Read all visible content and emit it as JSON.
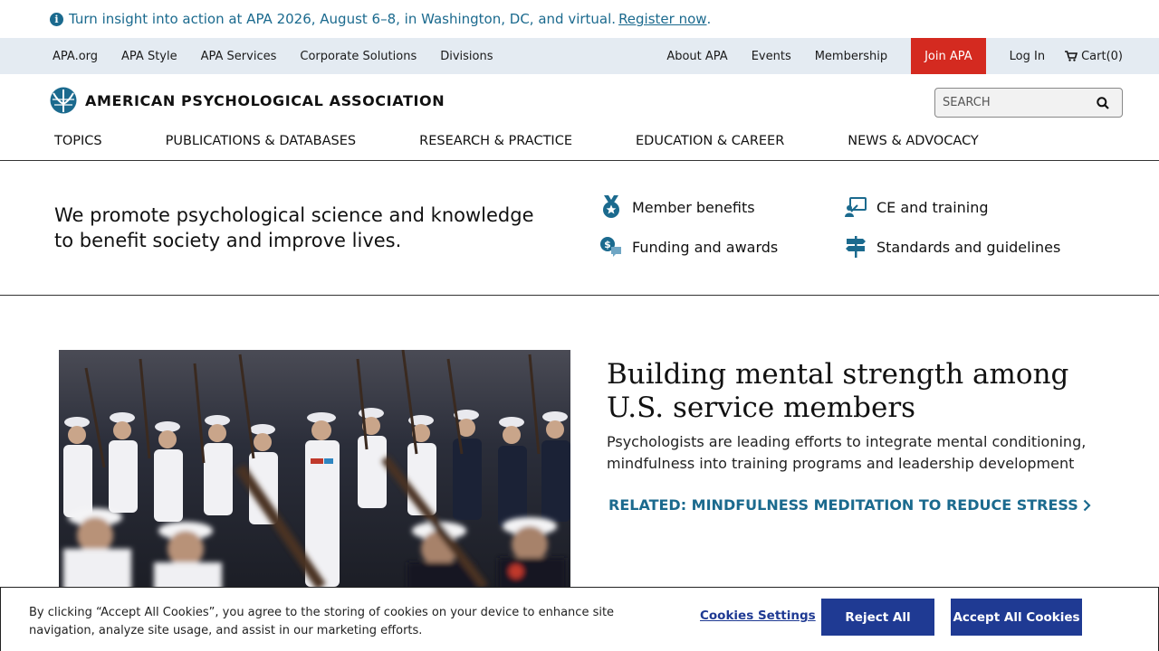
{
  "alert": {
    "message": "Turn insight into action at APA 2026, August 6–8, in Washington, DC, and virtual.",
    "link": "Register now",
    "trailing": "."
  },
  "util_nav": {
    "left": [
      "APA.org",
      "APA Style",
      "APA Services",
      "Corporate Solutions",
      "Divisions"
    ],
    "about": "About APA",
    "events": "Events",
    "membership": "Membership",
    "join": "Join APA",
    "login": "Log In",
    "cart": "Cart(0)"
  },
  "header": {
    "logo_text": "AMERICAN PSYCHOLOGICAL ASSOCIATION",
    "search_placeholder": "SEARCH",
    "nav": [
      "TOPICS",
      "PUBLICATIONS & DATABASES",
      "RESEARCH & PRACTICE",
      "EDUCATION & CAREER",
      "NEWS & ADVOCACY"
    ]
  },
  "mission": {
    "text": "We promote psychological science and knowledge to benefit society and improve lives.",
    "links": {
      "member_benefits": "Member benefits",
      "ce_training": "CE and training",
      "funding_awards": "Funding and awards",
      "standards": "Standards and guidelines"
    }
  },
  "feature": {
    "title": "Building mental strength among U.S. service members",
    "description": "Psychologists are leading efforts to integrate mental conditioning, mindfulness into training programs and leadership development",
    "related": "RELATED: MINDFULNESS MEDITATION TO REDUCE STRESS"
  },
  "cookie": {
    "text": "By clicking “Accept All Cookies”, you agree to the storing of cookies on your device to enhance site navigation, analyze site usage, and assist in our marketing efforts.",
    "settings": "Cookies Settings",
    "reject": "Reject All",
    "accept": "Accept All Cookies"
  },
  "colors": {
    "accent_blue": "#1b6a8e",
    "join_red": "#d42a20",
    "cookie_btn": "#1f3a93",
    "util_bg": "#e4ebf2"
  },
  "icons": {
    "alert": "info-icon",
    "cart": "cart-icon",
    "search": "search-icon",
    "member_benefits": "medal-icon",
    "ce_training": "presentation-icon",
    "funding_awards": "money-chat-icon",
    "standards": "signpost-icon",
    "related": "chevron-right-icon"
  }
}
